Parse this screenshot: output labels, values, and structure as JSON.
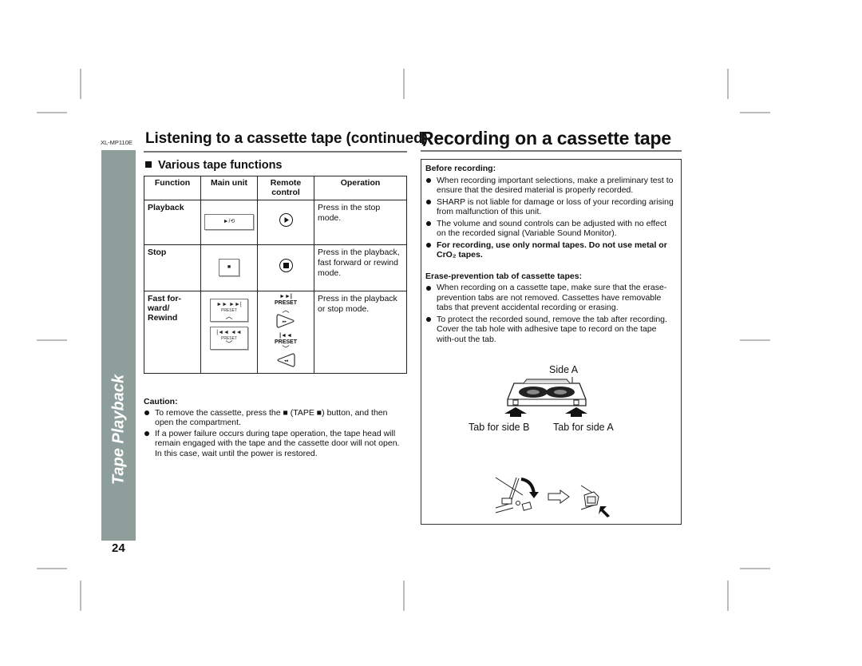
{
  "model": "XL-MP110E",
  "side_tab": "Tape Playback",
  "page_number": "24",
  "left": {
    "title": "Listening to a cassette tape (continued)",
    "section": "Various tape functions",
    "table": {
      "headers": [
        "Function",
        "Main unit",
        "Remote control",
        "Operation"
      ],
      "rows": [
        {
          "function": "Playback",
          "main_unit_button": "►/⟲",
          "remote_icon": "play-circle",
          "operation": "Press in the stop mode."
        },
        {
          "function": "Stop",
          "main_unit_button": "■",
          "remote_icon": "stop-circle",
          "operation": "Press in the playback, fast forward or rewind mode."
        },
        {
          "function": "Fast for-ward/ Rewind",
          "main_unit_buttons": [
            {
              "symbols": "►► ►►|",
              "label": "PRESET",
              "chevron": "^"
            },
            {
              "symbols": "|◄◄ ◄◄",
              "label": "PRESET",
              "chevron": "v"
            }
          ],
          "remote_buttons": [
            {
              "symbols": "►►|",
              "label": "PRESET",
              "chevron": "^",
              "icon": "fast-forward"
            },
            {
              "symbols": "|◄◄",
              "label": "PRESET",
              "chevron": "v",
              "icon": "rewind"
            }
          ],
          "operation": "Press in the playback or stop mode."
        }
      ]
    },
    "caution": {
      "heading": "Caution:",
      "items": [
        "To remove the cassette, press the ■ (TAPE ■) button, and then open the compartment.",
        "If a power failure occurs during tape operation, the tape head will remain engaged with the tape and the cassette door will not open. In this case, wait until the power is restored."
      ]
    }
  },
  "right": {
    "title": "Recording on a cassette tape",
    "before_heading": "Before recording:",
    "before_items": [
      "When recording important selections, make a preliminary test to ensure that the desired material is properly recorded.",
      "SHARP is not liable for damage or loss of your recording arising from malfunction of this unit.",
      "The volume and sound controls can be adjusted with no effect on the recorded signal (Variable Sound Monitor).",
      "For recording, use only normal tapes. Do not use metal or CrO₂ tapes."
    ],
    "erase_heading": "Erase-prevention tab of cassette tapes:",
    "erase_items": [
      "When recording on a cassette tape, make sure that the erase-prevention tabs are not removed. Cassettes have removable tabs that prevent accidental recording or erasing.",
      "To protect the recorded sound, remove the tab after recording. Cover the tab hole with adhesive tape to record on the tape with-out the tab."
    ],
    "figure": {
      "side_label": "Side A",
      "tab_b_label": "Tab for side B",
      "tab_a_label": "Tab for side A"
    }
  }
}
